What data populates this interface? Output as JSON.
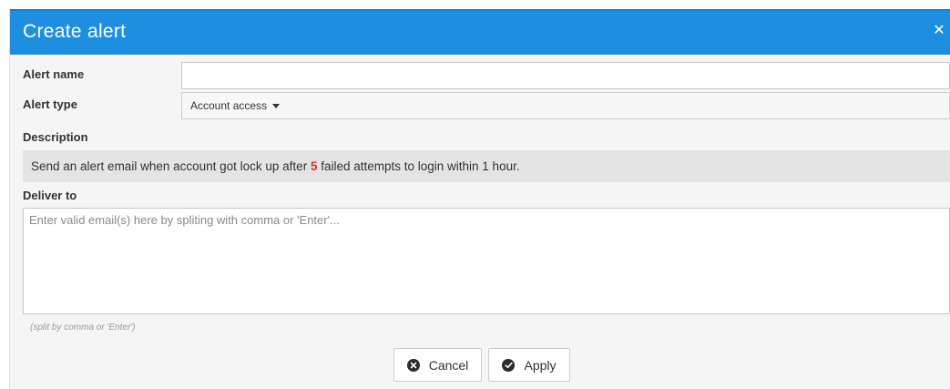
{
  "dialog": {
    "title": "Create alert",
    "close_icon": "close-icon"
  },
  "form": {
    "alert_name": {
      "label": "Alert name",
      "value": "",
      "placeholder": ""
    },
    "alert_type": {
      "label": "Alert type",
      "selected": "Account access"
    },
    "description": {
      "label": "Description",
      "text_before": "Send an alert email when account got lock up after ",
      "count": "5",
      "text_after": " failed attempts to login within 1 hour."
    },
    "deliver_to": {
      "label": "Deliver to",
      "value": "",
      "placeholder": "Enter valid email(s) here by spliting with comma or 'Enter'...",
      "hint": "(split by comma or 'Enter')"
    }
  },
  "buttons": {
    "cancel_label": "Cancel",
    "cancel_icon": "cancel-circle-icon",
    "apply_label": "Apply",
    "apply_icon": "check-circle-icon"
  },
  "colors": {
    "header": "#1e8fe0",
    "count_highlight": "#d9302c"
  }
}
